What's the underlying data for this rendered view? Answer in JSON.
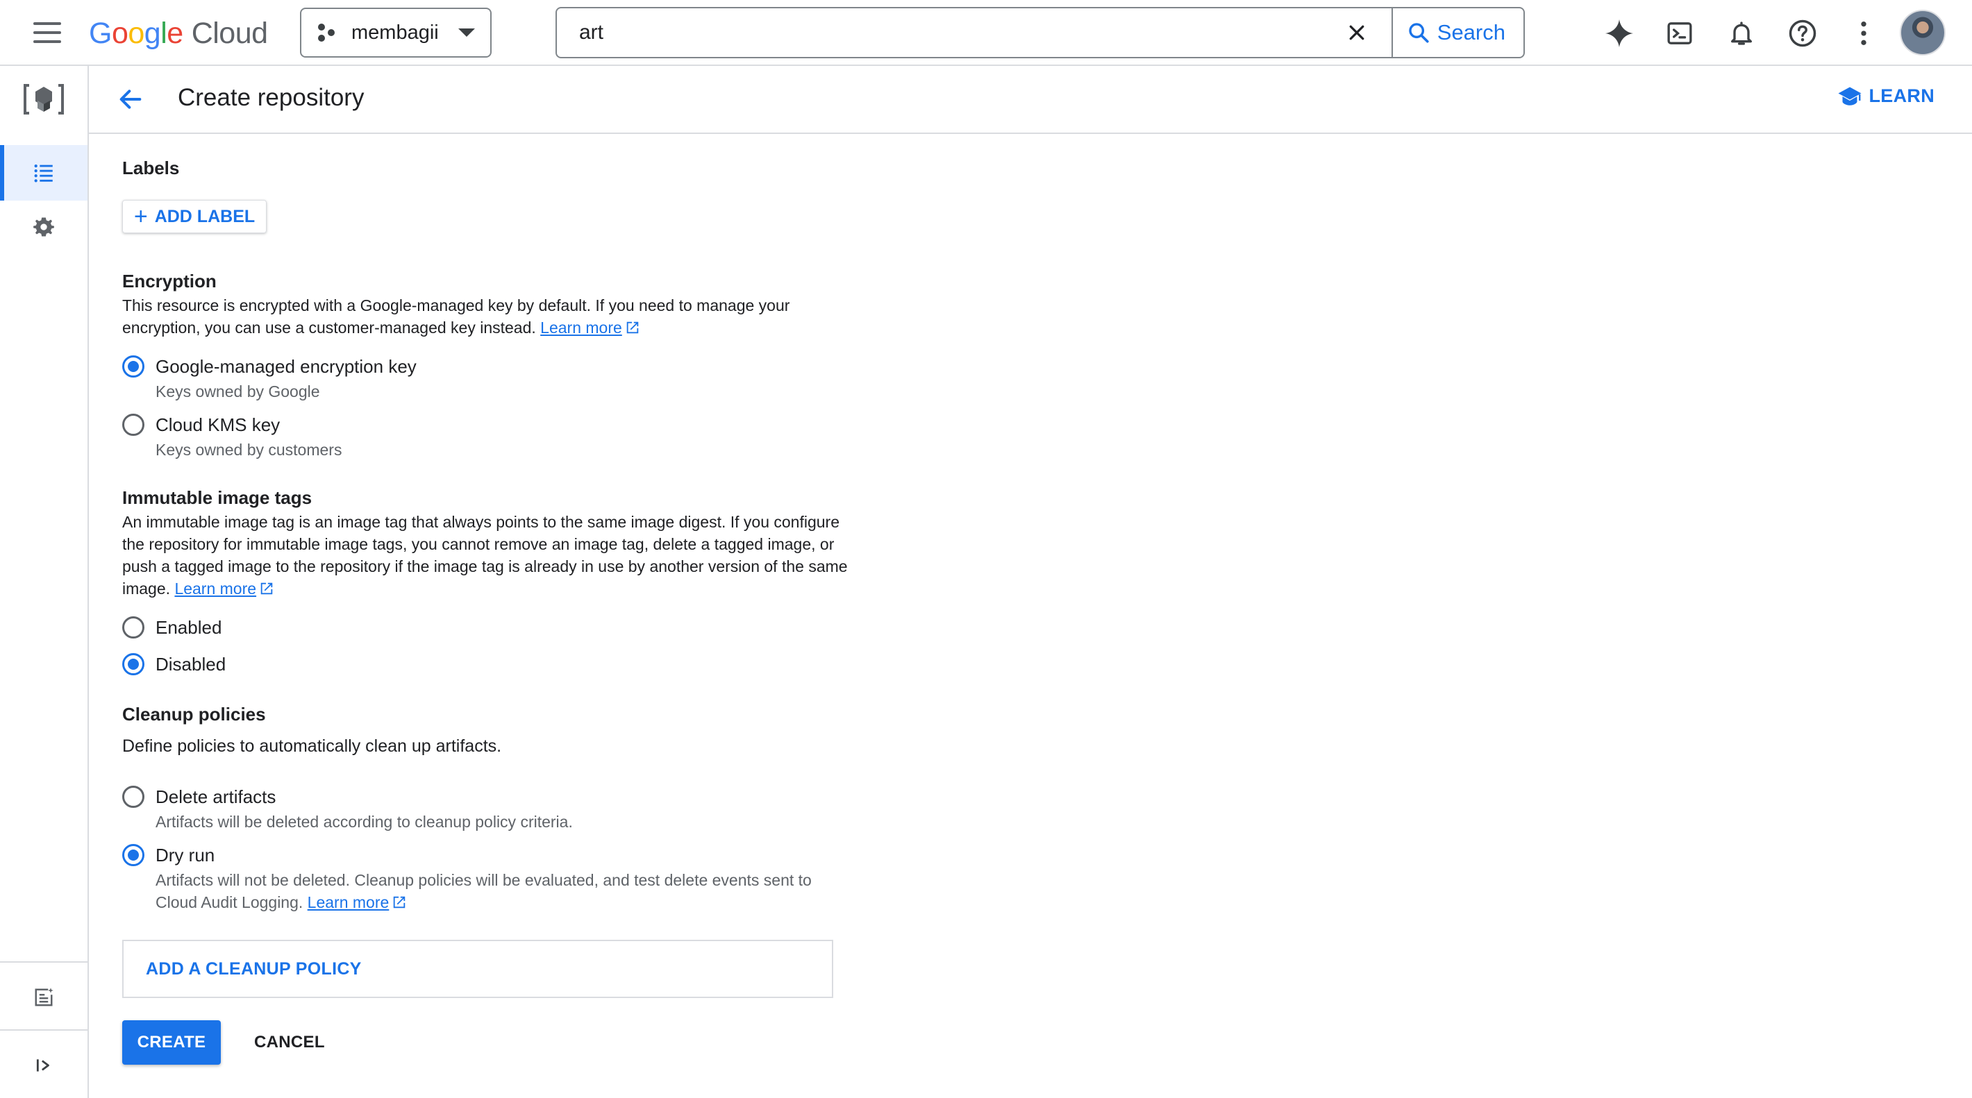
{
  "topbar": {
    "logo": {
      "g1": "G",
      "g2": "o",
      "g3": "o",
      "g4": "g",
      "g5": "l",
      "g6": "e",
      "cloud": "Cloud"
    },
    "project_name": "membagii",
    "search_value": "art",
    "search_button_label": "Search",
    "icons": [
      "menu-icon",
      "gemini-sparkle-icon",
      "cloud-shell-icon",
      "notifications-bell-icon",
      "help-icon",
      "more-vert-icon"
    ]
  },
  "rail": {
    "items": [
      "list-icon",
      "settings-gear-icon",
      "release-notes-icon",
      "expand-panel-icon"
    ]
  },
  "header": {
    "title": "Create repository",
    "learn_label": "LEARN"
  },
  "labels": {
    "title": "Labels",
    "add_label": "ADD LABEL"
  },
  "encryption": {
    "title": "Encryption",
    "description": "This resource is encrypted with a Google-managed key by default. If you need to manage your encryption, you can use a customer-managed key instead.",
    "learn_more": "Learn more",
    "options": [
      {
        "label": "Google-managed encryption key",
        "sub": "Keys owned by Google",
        "checked": true
      },
      {
        "label": "Cloud KMS key",
        "sub": "Keys owned by customers",
        "checked": false
      }
    ]
  },
  "immutable": {
    "title": "Immutable image tags",
    "description": "An immutable image tag is an image tag that always points to the same image digest. If you configure the repository for immutable image tags, you cannot remove an image tag, delete a tagged image, or push a tagged image to the repository if the image tag is already in use by another version of the same image.",
    "learn_more": "Learn more",
    "options": [
      {
        "label": "Enabled",
        "checked": false
      },
      {
        "label": "Disabled",
        "checked": true
      }
    ]
  },
  "cleanup": {
    "title": "Cleanup policies",
    "description": "Define policies to automatically clean up artifacts.",
    "options": [
      {
        "label": "Delete artifacts",
        "sub": "Artifacts will be deleted according to cleanup policy criteria.",
        "checked": false
      },
      {
        "label": "Dry run",
        "sub": "Artifacts will not be deleted. Cleanup policies will be evaluated, and test delete events sent to Cloud Audit Logging.",
        "checked": true
      }
    ],
    "learn_more": "Learn more",
    "add_policy": "ADD A CLEANUP POLICY"
  },
  "actions": {
    "create": "CREATE",
    "cancel": "CANCEL"
  },
  "colors": {
    "accent": "#1a73e8",
    "text": "#202124",
    "secondary_text": "#5f6368",
    "border": "#dadce0",
    "active_bg": "#e8f0fe"
  }
}
